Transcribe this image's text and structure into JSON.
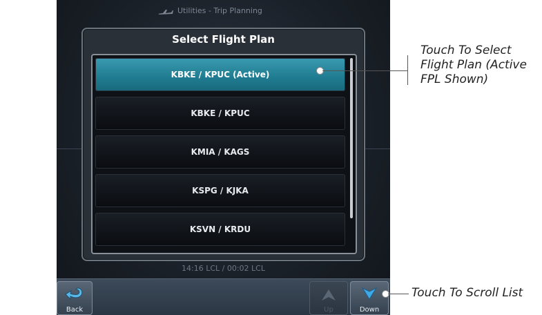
{
  "screen": {
    "title": "Utilities - Trip Planning",
    "dialog_title": "Select Flight Plan",
    "flight_plans": [
      {
        "label": "KBKE / KPUC (Active)",
        "active": true
      },
      {
        "label": "KBKE / KPUC",
        "active": false
      },
      {
        "label": "KMIA / KAGS",
        "active": false
      },
      {
        "label": "KSPG / KJKA",
        "active": false
      },
      {
        "label": "KSVN / KRDU",
        "active": false
      }
    ],
    "footer_times": "14:16 LCL / 00:02 LCL",
    "soft_keys": {
      "back": "Back",
      "up": "Up",
      "down": "Down"
    }
  },
  "callouts": {
    "select_plan": [
      "Touch To Select",
      "Flight Plan (Active",
      "FPL Shown)"
    ],
    "scroll_list": "Touch To Scroll List"
  },
  "colors": {
    "active_item": "#2a8ea3",
    "dialog_bg": "#2a3038",
    "soft_key": "#4b5968"
  },
  "icons": [
    "airplane-icon",
    "back-arrow-icon",
    "up-arrow-icon",
    "down-arrow-icon"
  ]
}
